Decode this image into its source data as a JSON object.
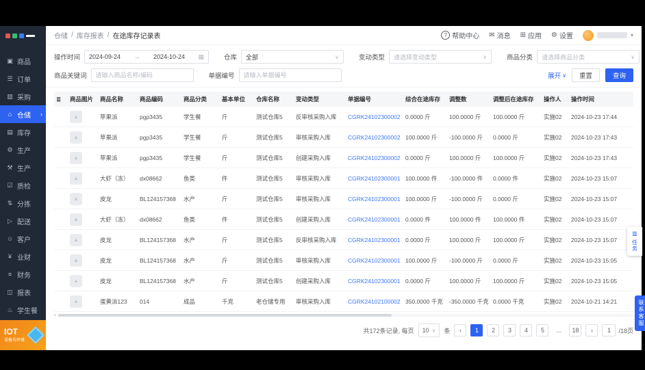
{
  "colors": {
    "accent": "#2e62f1",
    "sidebar_bg": "#212936",
    "link": "#3f78f7",
    "iot_orange": "#f08519",
    "table_header_bg": "#f5f6f8"
  },
  "icons": {
    "goods-icon": "▣",
    "orders-icon": "☰",
    "purchase-icon": "▥",
    "warehouse-icon": "⌂",
    "inventory-icon": "▤",
    "production-icon": "⚙",
    "production2-icon": "⚒",
    "qc-icon": "☑",
    "sorting-icon": "⇅",
    "delivery-icon": "▷",
    "customer-icon": "☺",
    "bizfin-icon": "¥",
    "finance-icon": "¤",
    "report-icon": "◫",
    "studentmeal-icon": "♨",
    "help-icon": "?",
    "message-icon": "✉",
    "apps-icon": "⊞",
    "gear-icon": "⚙",
    "calendar-icon": "▦",
    "caret-down-icon": "∨",
    "arrow-right-icon": "→",
    "column-settings-icon": "≣",
    "image-icon": "▲",
    "chevron-right-icon": "›",
    "prev-icon": "‹",
    "next-icon": "›",
    "scroll-left-icon": "‹",
    "user-caret-icon": "▾"
  },
  "sidebar": {
    "items": [
      {
        "id": "goods",
        "label": "商品",
        "icon": "goods-icon"
      },
      {
        "id": "orders",
        "label": "订单",
        "icon": "orders-icon"
      },
      {
        "id": "purchase",
        "label": "采购",
        "icon": "purchase-icon"
      },
      {
        "id": "warehouse",
        "label": "仓储",
        "icon": "warehouse-icon",
        "active": true
      },
      {
        "id": "inventory",
        "label": "库存",
        "icon": "inventory-icon"
      },
      {
        "id": "production",
        "label": "生产",
        "icon": "production-icon"
      },
      {
        "id": "production-2",
        "label": "生产",
        "icon": "production2-icon"
      },
      {
        "id": "quality",
        "label": "质检",
        "icon": "qc-icon"
      },
      {
        "id": "sorting",
        "label": "分拣",
        "icon": "sorting-icon"
      },
      {
        "id": "delivery",
        "label": "配送",
        "icon": "delivery-icon"
      },
      {
        "id": "customer",
        "label": "客户",
        "icon": "customer-icon"
      },
      {
        "id": "biz-finance",
        "label": "业财",
        "icon": "bizfin-icon"
      },
      {
        "id": "finance",
        "label": "财务",
        "icon": "finance-icon"
      },
      {
        "id": "report",
        "label": "报表",
        "icon": "report-icon"
      },
      {
        "id": "student-meal",
        "label": "学生餐",
        "icon": "studentmeal-icon"
      }
    ],
    "iot": {
      "title": "IOT",
      "subtitle": "设备与环境"
    }
  },
  "topbar": {
    "breadcrumb": [
      "仓储",
      "库存报表",
      "在途库存记录表"
    ],
    "actions": [
      {
        "id": "help-center",
        "label": "帮助中心",
        "icon": "help-icon"
      },
      {
        "id": "messages",
        "label": "消息",
        "icon": "message-icon"
      },
      {
        "id": "apps",
        "label": "应用",
        "icon": "apps-icon"
      },
      {
        "id": "settings",
        "label": "设置",
        "icon": "gear-icon"
      }
    ]
  },
  "filters": {
    "row1": [
      {
        "label": "操作时间",
        "start": "2024-09-24",
        "end": "2024-10-24"
      },
      {
        "label": "仓库",
        "value": "全部"
      },
      {
        "label": "变动类型",
        "placeholder": "请选择变动类型"
      },
      {
        "label": "商品分类",
        "placeholder": "请选择商品分类"
      }
    ],
    "row2": [
      {
        "label": "商品关键词",
        "placeholder": "请输入商品名称/编码"
      },
      {
        "label": "单据编号",
        "placeholder": "请输入单据编号"
      }
    ],
    "expand_label": "展开",
    "reset_label": "重置",
    "query_label": "查询"
  },
  "table": {
    "columns": [
      "商品图片",
      "商品名称",
      "商品编码",
      "商品分类",
      "基本单位",
      "仓库名称",
      "变动类型",
      "单据编号",
      "综合在途库存",
      "调整数",
      "调整后在途库存",
      "操作人",
      "操作时间"
    ],
    "rows": [
      {
        "name": "苹果派",
        "code": "pgp3435",
        "category": "学生餐",
        "unit": "斤",
        "warehouse": "测试仓库5",
        "change_type": "反审核采购入库",
        "doc_no": "CGRK24102300002",
        "before": "0.0000 斤",
        "adjust": "100.0000 斤",
        "after": "100.0000 斤",
        "operator": "实施02",
        "time": "2024-10-23 17:44"
      },
      {
        "name": "苹果派",
        "code": "pgp3435",
        "category": "学生餐",
        "unit": "斤",
        "warehouse": "测试仓库5",
        "change_type": "审核采购入库",
        "doc_no": "CGRK24102300002",
        "before": "100.0000 斤",
        "adjust": "-100.0000 斤",
        "after": "0.0000 斤",
        "operator": "实施02",
        "time": "2024-10-23 17:43"
      },
      {
        "name": "苹果派",
        "code": "pgp3435",
        "category": "学生餐",
        "unit": "斤",
        "warehouse": "测试仓库5",
        "change_type": "创建采购入库",
        "doc_no": "CGRK24102300002",
        "before": "0.0000 斤",
        "adjust": "100.0000 斤",
        "after": "100.0000 斤",
        "operator": "实施02",
        "time": "2024-10-23 17:43"
      },
      {
        "name": "大虾（冻）",
        "code": "dx08662",
        "category": "鱼类",
        "unit": "件",
        "warehouse": "测试仓库5",
        "change_type": "审核采购入库",
        "doc_no": "CGRK24102300001",
        "before": "100.0000 件",
        "adjust": "-100.0000 件",
        "after": "0.0000 件",
        "operator": "实施02",
        "time": "2024-10-23 15:07"
      },
      {
        "name": "皮龙",
        "code": "BL124157368",
        "category": "水产",
        "unit": "斤",
        "warehouse": "测试仓库5",
        "change_type": "审核采购入库",
        "doc_no": "CGRK24102300001",
        "before": "100.0000 斤",
        "adjust": "-100.0000 斤",
        "after": "0.0000 斤",
        "operator": "实施02",
        "time": "2024-10-23 15:07"
      },
      {
        "name": "大虾（冻）",
        "code": "dx08662",
        "category": "鱼类",
        "unit": "件",
        "warehouse": "测试仓库5",
        "change_type": "创建采购入库",
        "doc_no": "CGRK24102300001",
        "before": "0.0000 件",
        "adjust": "100.0000 件",
        "after": "100.0000 件",
        "operator": "实施02",
        "time": "2024-10-23 15:07"
      },
      {
        "name": "皮龙",
        "code": "BL124157368",
        "category": "水产",
        "unit": "斤",
        "warehouse": "测试仓库5",
        "change_type": "反审核采购入库",
        "doc_no": "CGRK24102300001",
        "before": "0.0000 斤",
        "adjust": "100.0000 斤",
        "after": "100.0000 斤",
        "operator": "实施02",
        "time": "2024-10-23 15:07"
      },
      {
        "name": "皮龙",
        "code": "BL124157368",
        "category": "水产",
        "unit": "斤",
        "warehouse": "测试仓库5",
        "change_type": "审核采购入库",
        "doc_no": "CGRK24102300001",
        "before": "100.0000 斤",
        "adjust": "-100.0000 斤",
        "after": "0.0000 斤",
        "operator": "实施02",
        "time": "2024-10-23 15:05"
      },
      {
        "name": "皮龙",
        "code": "BL124157368",
        "category": "水产",
        "unit": "斤",
        "warehouse": "测试仓库5",
        "change_type": "创建采购入库",
        "doc_no": "CGRK24102300001",
        "before": "0.0000 斤",
        "adjust": "100.0000 斤",
        "after": "100.0000 斤",
        "operator": "实施02",
        "time": "2024-10-23 15:05"
      },
      {
        "name": "蛋黄派123",
        "code": "014",
        "category": "成品",
        "unit": "千克",
        "warehouse": "老仓储专用",
        "change_type": "审核采购入库",
        "doc_no": "CGRK24102100002",
        "before": "350.0000 千克",
        "adjust": "-350.0000 千克",
        "after": "0.0000 千克",
        "operator": "实施02",
        "time": "2024-10-21 14:21"
      }
    ]
  },
  "pagination": {
    "total_text": "共172条记录, 每页",
    "page_size": "10",
    "unit_text": "条",
    "pages": [
      "1",
      "2",
      "3",
      "4",
      "5",
      "...",
      "18"
    ],
    "current": "1",
    "jump_value": "1",
    "jump_suffix": "/18页"
  },
  "floats": {
    "tasks_label": "任务",
    "service_label": "联系客服"
  }
}
